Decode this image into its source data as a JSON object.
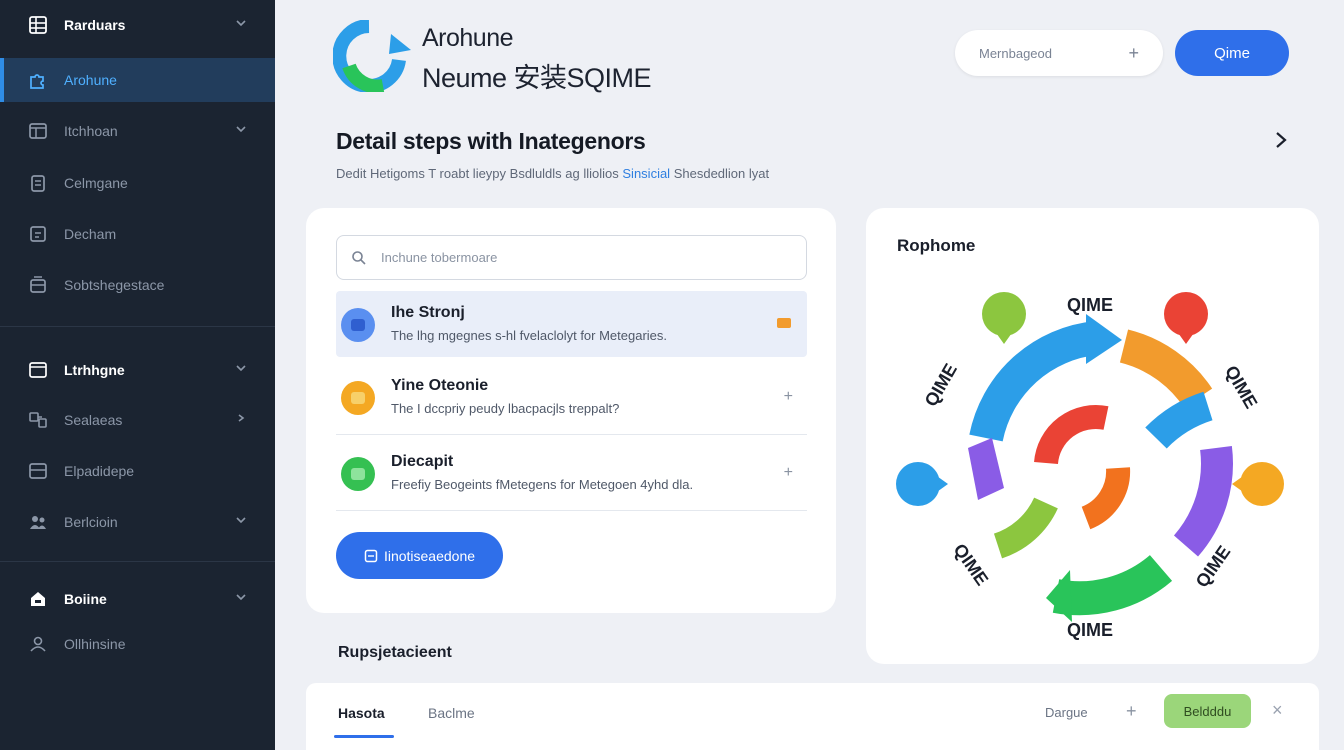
{
  "sidebar": {
    "header": "Rarduars",
    "items": [
      {
        "label": "Arohune",
        "icon": "puzzle-icon",
        "active": true
      },
      {
        "label": "Itchhoan",
        "icon": "window-icon"
      },
      {
        "label": "Celmgane",
        "icon": "clipboard-icon"
      },
      {
        "label": "Decham",
        "icon": "document-icon"
      },
      {
        "label": "Sobtshegestace",
        "icon": "stack-icon"
      }
    ],
    "section1": "Ltrhhgne",
    "section1_items": [
      {
        "label": "Sealaeas",
        "icon": "nodes-icon"
      },
      {
        "label": "Elpadidepe",
        "icon": "panel-icon"
      },
      {
        "label": "Berlcioin",
        "icon": "users-icon"
      }
    ],
    "section2": "Boiine",
    "section2_items": [
      {
        "label": "Ollhinsine",
        "icon": "person-icon"
      }
    ]
  },
  "brand": {
    "line1": "Arohune",
    "line2": "Neume 安装SQIME"
  },
  "top_search": {
    "placeholder": "Mernbageod",
    "plus": "+"
  },
  "top_button": "Qime",
  "page": {
    "title": "Detail steps with Inategenors",
    "desc_part1": "Dedit Hetigoms T roabt lieypy Bsdluldls ag lliolios",
    "desc_link": "Sinsicial",
    "desc_part2": "Shesdedlion lyat"
  },
  "left_card": {
    "search_placeholder": "Inchune tobermoare",
    "items": [
      {
        "title": "Ihe Stronj",
        "subtitle": "The lhg mgegnes s-hl fvelaclolyt for Metegaries."
      },
      {
        "title": "Yine Oteonie",
        "subtitle": "The I dccpriy peudy lbacpacjls treppalt?",
        "action": "+"
      },
      {
        "title": "Diecapit",
        "subtitle": "Freefiy Beogeints fMetegens for Metegoen 4yhd dla.",
        "action": "+"
      }
    ],
    "button": "Iinotiseaedone"
  },
  "right_card": {
    "title": "Rophome",
    "diagram_labels": [
      "QIME",
      "QIME",
      "QIME",
      "QIME",
      "QIME",
      "QIME"
    ]
  },
  "section_title": "Rupsjetacieent",
  "bottom_bar": {
    "tabs": [
      {
        "label": "Hasota",
        "active": true
      },
      {
        "label": "Baclme"
      }
    ],
    "text": "Dargue",
    "plus": "+",
    "green_button": "Beldddu",
    "close": "×"
  },
  "colors": {
    "sidebar_bg": "#1b2431",
    "accent_blue": "#2f6fea",
    "active_text": "#4fb0ff",
    "green_button": "#9bd67a"
  }
}
